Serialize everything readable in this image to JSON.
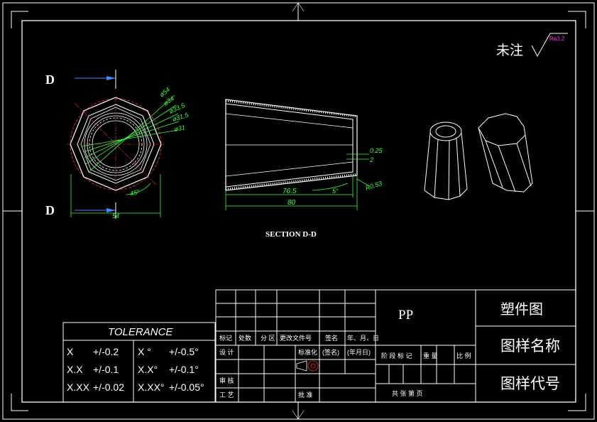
{
  "roughness": {
    "label": "未注",
    "value": "Ra3.2"
  },
  "section": {
    "letter_top": "D",
    "letter_bottom": "D",
    "caption": "SECTION D-D"
  },
  "dims_left": {
    "d54": "ø54",
    "d34": "ø34",
    "d33_5": "ø33.5",
    "d31_5": "ø31.5",
    "d31": "ø31",
    "angle": "45°",
    "width": "54"
  },
  "dims_mid": {
    "d0_25": "0.25",
    "d2": "2",
    "r0_53": "R0.53",
    "len76_5": "76.5",
    "angle5": "5°",
    "len80": "80"
  },
  "tolerance": {
    "title": "TOLERANCE",
    "rows": [
      {
        "a": "X",
        "b": "+/-0.2",
        "c": "X °",
        "d": "+/-0.5°"
      },
      {
        "a": "X.X",
        "b": "+/-0.1",
        "c": "X.X°",
        "d": "+/-0.1°"
      },
      {
        "a": "X.XX",
        "b": "+/-0.02",
        "c": "X.XX°",
        "d": "+/-0.05°"
      }
    ]
  },
  "title_block": {
    "material": "PP",
    "part_name": "塑件图",
    "drawing_name": "图样名称",
    "drawing_code": "图样代号",
    "h_mark": "标记",
    "h_count": "处数",
    "h_zone": "分 区",
    "h_doc": "更改文件号",
    "h_sign": "签名",
    "h_date": "年、月、日",
    "design": "设 计",
    "std": "标准化",
    "sign2": "(签名)",
    "date2": "(年月日)",
    "stage": "阶 段 标 记",
    "weight": "重 量",
    "ratio": "比 例",
    "review": "审 核",
    "process": "工 艺",
    "approve": "批 准",
    "sheets": "共   张   第   页"
  }
}
